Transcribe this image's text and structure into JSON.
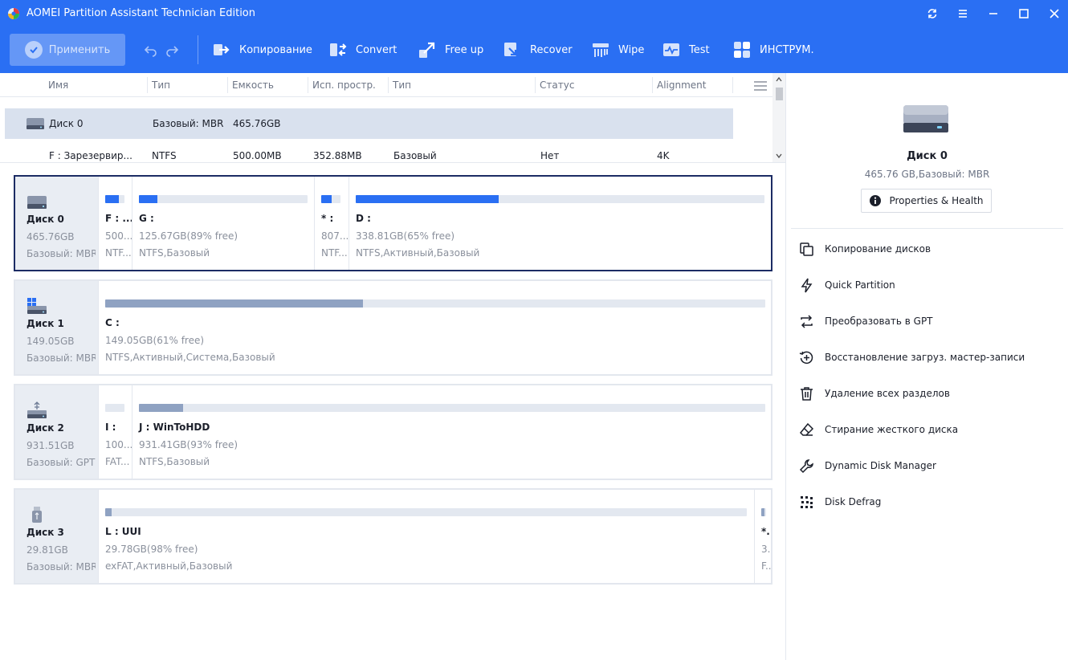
{
  "app": {
    "title": "AOMEI Partition Assistant Technician Edition"
  },
  "window_controls": [
    "refresh-icon",
    "menu-icon",
    "minimize-icon",
    "maximize-icon",
    "close-icon"
  ],
  "toolbar": {
    "apply_label": "Применить",
    "items": [
      {
        "label": "Копирование",
        "icon": "copy-icon"
      },
      {
        "label": "Convert",
        "icon": "convert-icon"
      },
      {
        "label": "Free up",
        "icon": "free-up-icon"
      },
      {
        "label": "Recover",
        "icon": "recover-icon"
      },
      {
        "label": "Wipe",
        "icon": "wipe-icon"
      },
      {
        "label": "Test",
        "icon": "test-icon"
      },
      {
        "label": "ИНСТРУМ.",
        "icon": "tools-icon"
      }
    ]
  },
  "grid": {
    "columns": [
      "Имя",
      "Тип",
      "Емкость",
      "Исп. простр.",
      "Тип",
      "Статус",
      "Alignment"
    ],
    "disk_row": {
      "name": "Диск 0",
      "type": "Базовый: MBR",
      "capacity": "465.76GB"
    },
    "partition_row": {
      "name": "F : Зарезервир...",
      "fs": "NTFS",
      "capacity": "500.00MB",
      "used": "352.88MB",
      "type": "Базовый",
      "status": "Нет",
      "alignment": "4K"
    }
  },
  "disks": [
    {
      "name": "Диск 0",
      "size": "465.76GB",
      "type": "Базовый: MBR",
      "icon": "hdd-icon",
      "selected": true,
      "partitions": [
        {
          "label": "F : ...",
          "capacity": "500...",
          "fs": "NTF...",
          "used_fraction": 0.7,
          "color": "#2a6ff3"
        },
        {
          "label": "G :",
          "capacity": "125.67GB(89% free)",
          "fs": "NTFS,Базовый",
          "used_fraction": 0.11,
          "color": "#2a6ff3"
        },
        {
          "label": "* :",
          "capacity": "807...",
          "fs": "NTF...",
          "used_fraction": 0.55,
          "color": "#2a6ff3"
        },
        {
          "label": "D :",
          "capacity": "338.81GB(65% free)",
          "fs": "NTFS,Активный,Базовый",
          "used_fraction": 0.35,
          "color": "#2a6ff3"
        }
      ]
    },
    {
      "name": "Диск 1",
      "size": "149.05GB",
      "type": "Базовый: MBR",
      "icon": "windows-disk-icon",
      "selected": false,
      "partitions": [
        {
          "label": "C :",
          "capacity": "149.05GB(61% free)",
          "fs": "NTFS,Активный,Система,Базовый",
          "used_fraction": 0.39,
          "color": "#8fa2c2"
        }
      ]
    },
    {
      "name": "Диск 2",
      "size": "931.51GB",
      "type": "Базовый: GPT",
      "icon": "usb-hdd-icon",
      "selected": false,
      "partitions": [
        {
          "label": "I :",
          "capacity": "100....",
          "fs": "FAT...",
          "used_fraction": 0.0,
          "color": "#8fa2c2"
        },
        {
          "label": "J : WinToHDD",
          "capacity": "931.41GB(93% free)",
          "fs": "NTFS,Базовый",
          "used_fraction": 0.07,
          "color": "#8fa2c2"
        }
      ]
    },
    {
      "name": "Диск 3",
      "size": "29.81GB",
      "type": "Базовый: MBR",
      "icon": "usb-stick-icon",
      "selected": false,
      "partitions": [
        {
          "label": "L : UUI",
          "capacity": "29.78GB(98% free)",
          "fs": "exFAT,Активный,Базовый",
          "used_fraction": 0.01,
          "color": "#8fa2c2"
        },
        {
          "label": "*...",
          "capacity": "3...",
          "fs": "F...",
          "used_fraction": 0.6,
          "color": "#8fa2c2"
        }
      ]
    }
  ],
  "details": {
    "name": "Диск 0",
    "subtitle": "465.76 GB,Базовый: MBR",
    "properties_label": "Properties & Health",
    "operations": [
      {
        "label": "Копирование дисков",
        "icon": "disk-copy-icon"
      },
      {
        "label": "Quick Partition",
        "icon": "lightning-icon"
      },
      {
        "label": "Преобразовать в GPT",
        "icon": "convert-arrows-icon"
      },
      {
        "label": "Восстановление загруз. мастер-записи",
        "icon": "rebuild-mbr-icon"
      },
      {
        "label": "Удаление всех разделов",
        "icon": "trash-icon"
      },
      {
        "label": "Стирание жесткого диска",
        "icon": "eraser-icon"
      },
      {
        "label": "Dynamic Disk Manager",
        "icon": "wrench-icon"
      },
      {
        "label": "Disk Defrag",
        "icon": "defrag-icon"
      }
    ]
  }
}
